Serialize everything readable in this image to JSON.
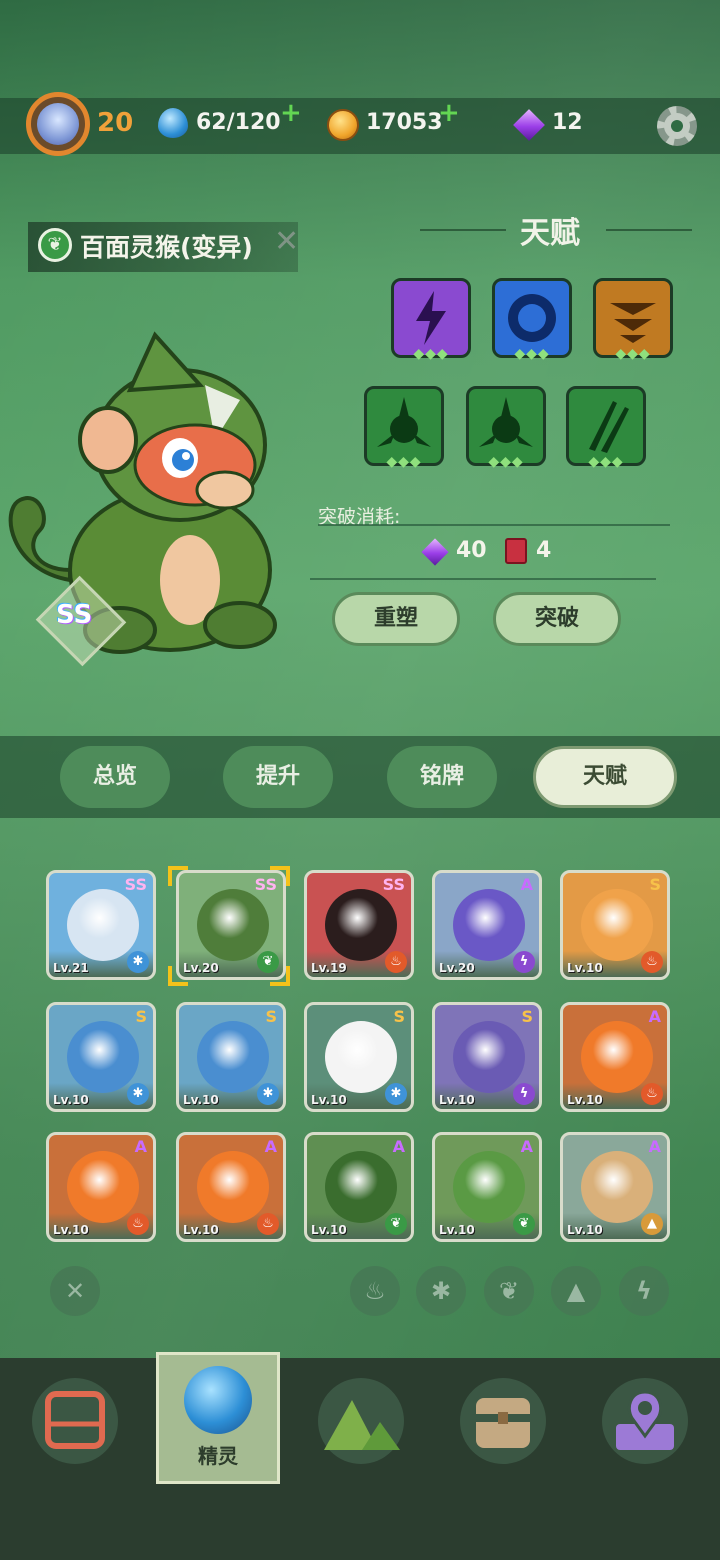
{
  "player": {
    "level": "20"
  },
  "resources": {
    "energy": "62/120",
    "coins": "17053",
    "gems": "12"
  },
  "pet": {
    "name": "百面灵猴(变异)",
    "rarity": "SS"
  },
  "talent": {
    "title": "天赋",
    "cost_label": "突破消耗:",
    "cost_gem": "40",
    "cost_book": "4",
    "reroll_label": "重塑",
    "breakthrough_label": "突破",
    "slots": [
      {
        "icon": "lightning-talent-icon",
        "color": "#8a4ad0"
      },
      {
        "icon": "gear-talent-icon",
        "color": "#2d6ed6"
      },
      {
        "icon": "stack-talent-icon",
        "color": "#c07a22"
      },
      {
        "icon": "blade-talent-icon",
        "color": "#2f8a3e"
      },
      {
        "icon": "blade-talent-icon",
        "color": "#2f8a3e"
      },
      {
        "icon": "claw-talent-icon",
        "color": "#2f8a3e"
      }
    ]
  },
  "tabs": [
    "总览",
    "提升",
    "铭牌",
    "天赋"
  ],
  "pets": [
    {
      "lv": "Lv.21",
      "rarity": "SS",
      "element": "ice",
      "bg": "#6fb1de",
      "creature": "#d7e5f2"
    },
    {
      "lv": "Lv.20",
      "rarity": "SS",
      "element": "leaf",
      "bg": "#7fb07a",
      "creature": "#4f7d3a"
    },
    {
      "lv": "Lv.19",
      "rarity": "SS",
      "element": "fire",
      "bg": "#c95252",
      "creature": "#2b1d1d"
    },
    {
      "lv": "Lv.20",
      "rarity": "A",
      "element": "thunder",
      "bg": "#8aa6c8",
      "creature": "#6a58c6"
    },
    {
      "lv": "Lv.10",
      "rarity": "S",
      "element": "fire",
      "bg": "#e39a46",
      "creature": "#f0a24a"
    },
    {
      "lv": "Lv.10",
      "rarity": "S",
      "element": "ice",
      "bg": "#6aa6c6",
      "creature": "#4a8ed0"
    },
    {
      "lv": "Lv.10",
      "rarity": "S",
      "element": "ice",
      "bg": "#6aa6c6",
      "creature": "#4a8ed0"
    },
    {
      "lv": "Lv.10",
      "rarity": "S",
      "element": "ice",
      "bg": "#5c8f7a",
      "creature": "#f4f4f4"
    },
    {
      "lv": "Lv.10",
      "rarity": "S",
      "element": "thunder",
      "bg": "#7f74b8",
      "creature": "#6a5bb4"
    },
    {
      "lv": "Lv.10",
      "rarity": "A",
      "element": "fire",
      "bg": "#c9703a",
      "creature": "#f07a2a"
    },
    {
      "lv": "Lv.10",
      "rarity": "A",
      "element": "fire",
      "bg": "#c9703a",
      "creature": "#f07a2a"
    },
    {
      "lv": "Lv.10",
      "rarity": "A",
      "element": "fire",
      "bg": "#c9703a",
      "creature": "#f07a2a"
    },
    {
      "lv": "Lv.10",
      "rarity": "A",
      "element": "leaf",
      "bg": "#5f8f52",
      "creature": "#3a6d2e"
    },
    {
      "lv": "Lv.10",
      "rarity": "A",
      "element": "leaf",
      "bg": "#6f9a5a",
      "creature": "#5a9a44"
    },
    {
      "lv": "Lv.10",
      "rarity": "A",
      "element": "earth",
      "bg": "#8aa89a",
      "creature": "#d9b07a"
    }
  ],
  "filters": [
    "clear-filter-icon",
    "fire-filter-icon",
    "ice-filter-icon",
    "leaf-filter-icon",
    "earth-filter-icon",
    "thunder-filter-icon"
  ],
  "nav": {
    "active_label": "精灵",
    "items": [
      "bag-nav-icon",
      "spirit-nav-icon",
      "mountain-nav-icon",
      "chest-nav-icon",
      "map-nav-icon"
    ]
  }
}
